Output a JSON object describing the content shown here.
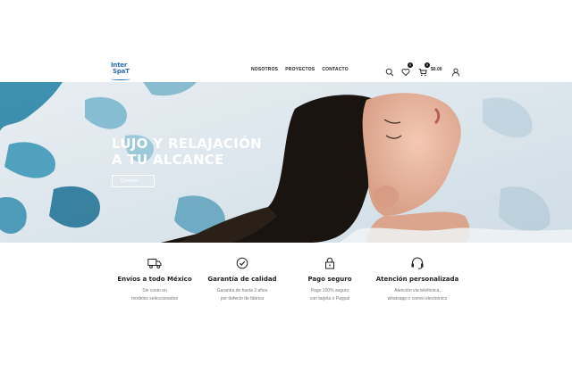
{
  "brand": {
    "logo_line1": "Inter",
    "logo_line2": "SpaT"
  },
  "nav": {
    "items": [
      "NOSOTROS",
      "PROYECTOS",
      "CONTACTO"
    ]
  },
  "header_icons": {
    "search": "search-icon",
    "wishlist": "heart-icon",
    "wishlist_count": "0",
    "cart": "cart-icon",
    "cart_count": "0",
    "cart_total": "$0.00",
    "account": "user-icon"
  },
  "hero": {
    "title_line1": "LUJO Y RELAJACIÓN",
    "title_line2": "A TU ALCANCE",
    "button_label": "Comprar",
    "button_arrow": "→"
  },
  "features": [
    {
      "icon": "truck-icon",
      "title": "Envíos a todo México",
      "line1": "Sin costo en",
      "line2": "modelos seleccionados"
    },
    {
      "icon": "check-circle-icon",
      "title": "Garantía de calidad",
      "line1": "Garantía de hasta 3 años",
      "line2": "por defecto de fábrica"
    },
    {
      "icon": "lock-icon",
      "title": "Pago seguro",
      "line1": "Pago 100% seguro",
      "line2": "con tarjeta o Paypal"
    },
    {
      "icon": "headset-icon",
      "title": "Atención personalizada",
      "line1": "Atención vía telefónica,",
      "line2": "whatsapp o correo electrónico"
    }
  ],
  "colors": {
    "brand_blue": "#2a6db3",
    "water_blue": "#1f7fa3",
    "text_dark": "#222222",
    "text_muted": "#777777"
  }
}
